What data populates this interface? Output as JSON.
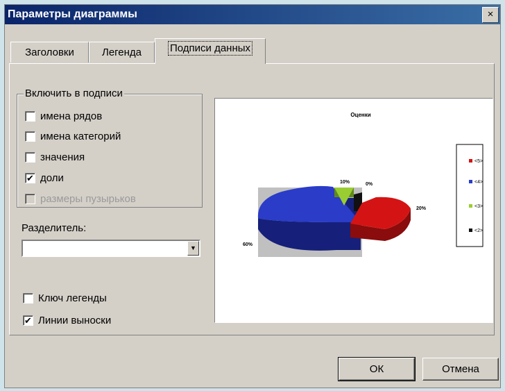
{
  "window": {
    "title": "Параметры диаграммы",
    "close_glyph": "×"
  },
  "tabs": [
    {
      "label": "Заголовки",
      "active": false
    },
    {
      "label": "Легенда",
      "active": false
    },
    {
      "label": "Подписи данных",
      "active": true
    }
  ],
  "include_group": {
    "title": "Включить в подписи",
    "items": [
      {
        "label": "имена рядов",
        "checked": false,
        "enabled": true
      },
      {
        "label": "имена категорий",
        "checked": false,
        "enabled": true
      },
      {
        "label": "значения",
        "checked": false,
        "enabled": true
      },
      {
        "label": "доли",
        "checked": true,
        "enabled": true
      },
      {
        "label": "размеры пузырьков",
        "checked": false,
        "enabled": false
      }
    ]
  },
  "separator": {
    "label": "Разделитель:",
    "value": ""
  },
  "legend_key": {
    "label": "Ключ легенды",
    "checked": false
  },
  "leader_lines": {
    "label": "Линии выноски",
    "checked": true
  },
  "preview": {
    "chart_title": "Оценки",
    "slices": [
      {
        "legend": "<5>",
        "label": "20%",
        "percent": 20,
        "color": "#d41414",
        "dark": "#8a0c0c"
      },
      {
        "legend": "<4>",
        "label": "60%",
        "percent": 60,
        "color": "#2a3cc8",
        "dark": "#16207a"
      },
      {
        "legend": "<3>",
        "label": "10%",
        "percent": 10,
        "color": "#9acd32",
        "dark": "#5f8a18"
      },
      {
        "legend": "<2>",
        "label": "0%",
        "percent": 0,
        "color": "#111111",
        "dark": "#000000"
      }
    ],
    "check_glyph": "✔"
  },
  "buttons": {
    "ok": "ОК",
    "cancel": "Отмена"
  }
}
